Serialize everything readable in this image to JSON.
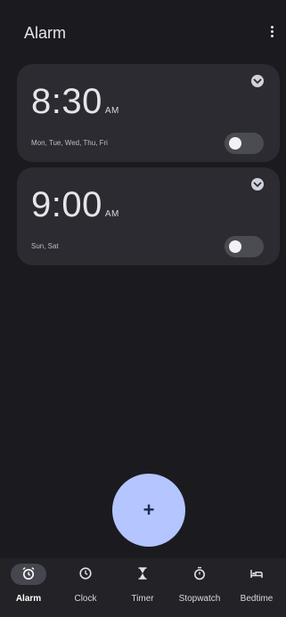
{
  "header": {
    "title": "Alarm",
    "menu_icon": "more-vert-icon"
  },
  "alarms": [
    {
      "time": "8:30",
      "ampm": "AM",
      "days": "Mon, Tue, Wed, Thu, Fri",
      "enabled": false
    },
    {
      "time": "9:00",
      "ampm": "AM",
      "days": "Sun, Sat",
      "enabled": false
    }
  ],
  "fab": {
    "label": "+",
    "icon": "add-icon"
  },
  "nav": [
    {
      "label": "Alarm",
      "icon": "alarm-icon",
      "active": true
    },
    {
      "label": "Clock",
      "icon": "clock-icon",
      "active": false
    },
    {
      "label": "Timer",
      "icon": "hourglass-icon",
      "active": false
    },
    {
      "label": "Stopwatch",
      "icon": "stopwatch-icon",
      "active": false
    },
    {
      "label": "Bedtime",
      "icon": "bed-icon",
      "active": false
    }
  ],
  "colors": {
    "background": "#1b1b1f",
    "card": "#2b2b31",
    "accent": "#b4c5ff"
  }
}
